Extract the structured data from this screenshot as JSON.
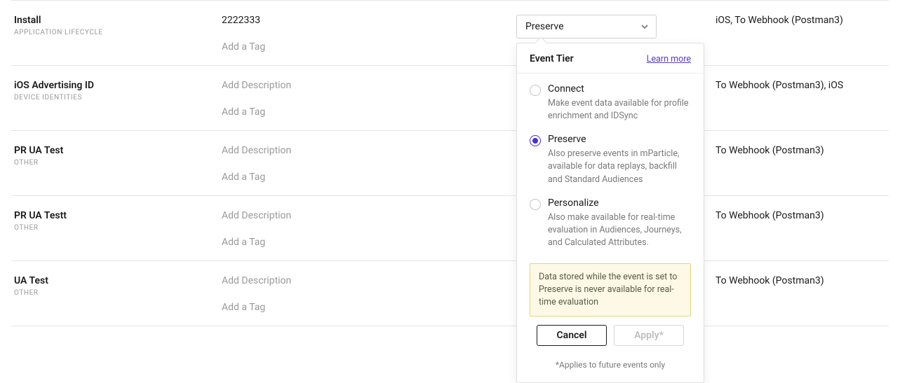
{
  "rows": [
    {
      "name": "Install",
      "category": "APPLICATION LIFECYCLE",
      "description": "2222333",
      "tag_placeholder": "Add a Tag",
      "tier_selected": "Preserve",
      "destinations": "iOS, To Webhook (Postman3)"
    },
    {
      "name": "iOS Advertising ID",
      "category": "DEVICE IDENTITIES",
      "description": "",
      "desc_placeholder": "Add Description",
      "tag_placeholder": "Add a Tag",
      "destinations": "To Webhook (Postman3), iOS"
    },
    {
      "name": "PR UA Test",
      "category": "OTHER",
      "description": "",
      "desc_placeholder": "Add Description",
      "tag_placeholder": "Add a Tag",
      "destinations": "To Webhook (Postman3)"
    },
    {
      "name": "PR UA Testt",
      "category": "OTHER",
      "description": "",
      "desc_placeholder": "Add Description",
      "tag_placeholder": "Add a Tag",
      "destinations": "To Webhook (Postman3)"
    },
    {
      "name": "UA Test",
      "category": "OTHER",
      "description": "",
      "desc_placeholder": "Add Description",
      "tag_placeholder": "Add a Tag",
      "destinations": "To Webhook (Postman3)"
    }
  ],
  "popover": {
    "title": "Event Tier",
    "learn_more": "Learn more",
    "options": [
      {
        "key": "connect",
        "label": "Connect",
        "desc": "Make event data available for profile enrichment and IDSync",
        "selected": false
      },
      {
        "key": "preserve",
        "label": "Preserve",
        "desc": "Also preserve events in mParticle, available for data replays, backfill and Standard Audiences",
        "selected": true
      },
      {
        "key": "personalize",
        "label": "Personalize",
        "desc": "Also make available for real-time evaluation in Audiences, Journeys, and Calculated Attributes.",
        "selected": false
      }
    ],
    "warning": "Data stored while the event is set to Preserve is never available for real-time evaluation",
    "cancel": "Cancel",
    "apply": "Apply*",
    "footnote": "*Applies to future events only"
  }
}
